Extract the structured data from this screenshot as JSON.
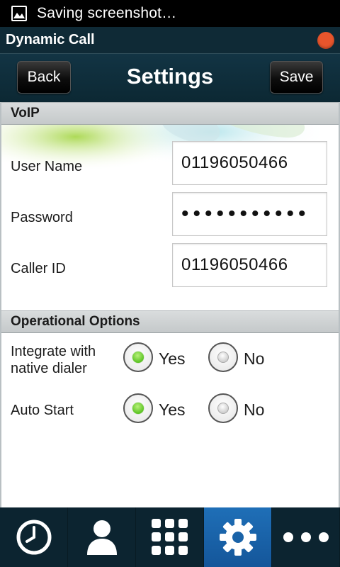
{
  "status_bar": {
    "notification": "Saving screenshot…",
    "icon": "image-icon"
  },
  "app": {
    "title": "Dynamic Call",
    "indicator_color": "#e8552c"
  },
  "header": {
    "back_label": "Back",
    "title": "Settings",
    "save_label": "Save"
  },
  "voip": {
    "section_title": "VoIP",
    "fields": [
      {
        "label": "User Name",
        "value": "01196050466"
      },
      {
        "label": "Password",
        "value": "•••••••••••"
      },
      {
        "label": "Caller ID",
        "value": "01196050466"
      }
    ]
  },
  "operational": {
    "section_title": "Operational Options",
    "options": [
      {
        "label_line1": "Integrate with",
        "label_line2": "native dialer",
        "yes": "Yes",
        "no": "No",
        "selected": "Yes"
      },
      {
        "label_line1": "Auto Start",
        "label_line2": "",
        "yes": "Yes",
        "no": "No",
        "selected": "Yes"
      }
    ]
  },
  "bottom_nav": [
    {
      "icon": "clock-icon",
      "active": false
    },
    {
      "icon": "contact-icon",
      "active": false
    },
    {
      "icon": "dialpad-icon",
      "active": false
    },
    {
      "icon": "settings-gear-icon",
      "active": true
    },
    {
      "icon": "more-icon",
      "active": false
    }
  ],
  "colors": {
    "accent_active": "#1f6fb7",
    "radio_selected": "#5cc424",
    "bar_background": "#0c2430"
  }
}
